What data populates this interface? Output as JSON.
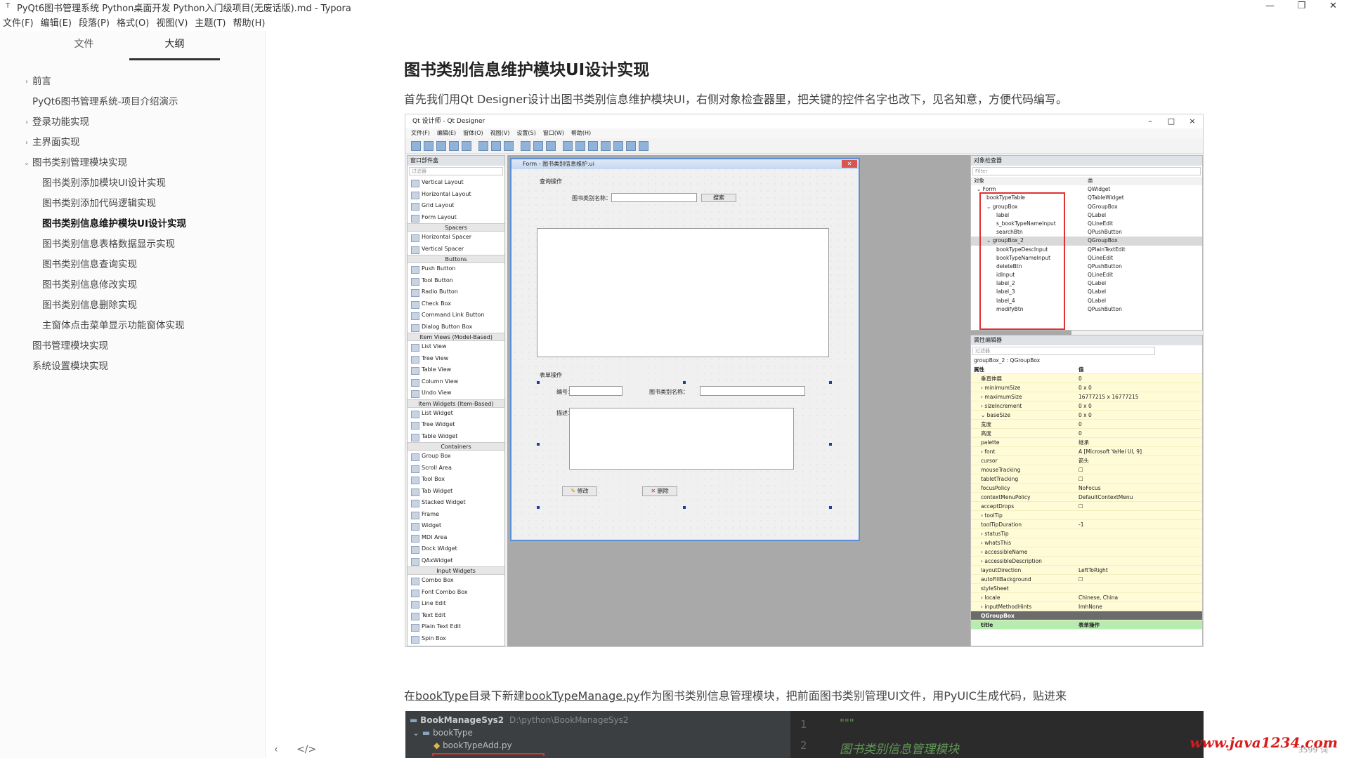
{
  "window": {
    "title": "PyQt6图书管理系统 Python桌面开发 Python入门级项目(无废话版).md - Typora",
    "min_symbol": "—",
    "max_symbol": "❐",
    "close_symbol": "✕"
  },
  "menu": [
    "文件(F)",
    "编辑(E)",
    "段落(P)",
    "格式(O)",
    "视图(V)",
    "主题(T)",
    "帮助(H)"
  ],
  "sidebar": {
    "tabs": [
      "文件",
      "大纲"
    ],
    "active_tab": 1,
    "outline": [
      {
        "label": "前言",
        "level": 0,
        "chevron": "›"
      },
      {
        "label": "PyQt6图书管理系统-项目介绍演示",
        "level": 0,
        "chevron": ""
      },
      {
        "label": "登录功能实现",
        "level": 0,
        "chevron": "›"
      },
      {
        "label": "主界面实现",
        "level": 0,
        "chevron": "›"
      },
      {
        "label": "图书类别管理模块实现",
        "level": 0,
        "chevron": "⌄"
      },
      {
        "label": "图书类别添加模块UI设计实现",
        "level": 1,
        "chevron": ""
      },
      {
        "label": "图书类别添加代码逻辑实现",
        "level": 1,
        "chevron": ""
      },
      {
        "label": "图书类别信息维护模块UI设计实现",
        "level": 1,
        "chevron": "",
        "active": true
      },
      {
        "label": "图书类别信息表格数据显示实现",
        "level": 1,
        "chevron": ""
      },
      {
        "label": "图书类别信息查询实现",
        "level": 1,
        "chevron": ""
      },
      {
        "label": "图书类别信息修改实现",
        "level": 1,
        "chevron": ""
      },
      {
        "label": "图书类别信息删除实现",
        "level": 1,
        "chevron": ""
      },
      {
        "label": "主窗体点击菜单显示功能窗体实现",
        "level": 1,
        "chevron": ""
      },
      {
        "label": "图书管理模块实现",
        "level": 0,
        "chevron": ""
      },
      {
        "label": "系统设置模块实现",
        "level": 0,
        "chevron": ""
      }
    ],
    "footer_left": "‹",
    "footer_code": "</>"
  },
  "content": {
    "heading": "图书类别信息维护模块UI设计实现",
    "para1": "首先我们用Qt Designer设计出图书类别信息维护模块UI，右侧对象检查器里，把关键的控件名字也改下，见名知意，方便代码编写。",
    "para2_pre": "在",
    "para2_link1": "bookType",
    "para2_mid": "目录下新建",
    "para2_link2": "bookTypeManage.py",
    "para2_post": "作为图书类别信息管理模块，把前面图书类别管理UI文件，用PyUIC生成代码，贴进来"
  },
  "designer": {
    "title": "Qt 设计师 - Qt Designer",
    "menu": [
      "文件(F)",
      "编辑(E)",
      "窗体(O)",
      "视图(V)",
      "设置(S)",
      "窗口(W)",
      "帮助(H)"
    ],
    "widgetbox_title": "窗口部件盒",
    "filter_placeholder": "过滤器",
    "widgets": [
      {
        "t": "item",
        "label": "Vertical Layout"
      },
      {
        "t": "item",
        "label": "Horizontal Layout"
      },
      {
        "t": "item",
        "label": "Grid Layout"
      },
      {
        "t": "item",
        "label": "Form Layout"
      },
      {
        "t": "cat",
        "label": "Spacers"
      },
      {
        "t": "item",
        "label": "Horizontal Spacer"
      },
      {
        "t": "item",
        "label": "Vertical Spacer"
      },
      {
        "t": "cat",
        "label": "Buttons"
      },
      {
        "t": "item",
        "label": "Push Button"
      },
      {
        "t": "item",
        "label": "Tool Button"
      },
      {
        "t": "item",
        "label": "Radio Button"
      },
      {
        "t": "item",
        "label": "Check Box"
      },
      {
        "t": "item",
        "label": "Command Link Button"
      },
      {
        "t": "item",
        "label": "Dialog Button Box"
      },
      {
        "t": "cat",
        "label": "Item Views (Model-Based)"
      },
      {
        "t": "item",
        "label": "List View"
      },
      {
        "t": "item",
        "label": "Tree View"
      },
      {
        "t": "item",
        "label": "Table View"
      },
      {
        "t": "item",
        "label": "Column View"
      },
      {
        "t": "item",
        "label": "Undo View"
      },
      {
        "t": "cat",
        "label": "Item Widgets (Item-Based)"
      },
      {
        "t": "item",
        "label": "List Widget"
      },
      {
        "t": "item",
        "label": "Tree Widget"
      },
      {
        "t": "item",
        "label": "Table Widget"
      },
      {
        "t": "cat",
        "label": "Containers"
      },
      {
        "t": "item",
        "label": "Group Box"
      },
      {
        "t": "item",
        "label": "Scroll Area"
      },
      {
        "t": "item",
        "label": "Tool Box"
      },
      {
        "t": "item",
        "label": "Tab Widget"
      },
      {
        "t": "item",
        "label": "Stacked Widget"
      },
      {
        "t": "item",
        "label": "Frame"
      },
      {
        "t": "item",
        "label": "Widget"
      },
      {
        "t": "item",
        "label": "MDI Area"
      },
      {
        "t": "item",
        "label": "Dock Widget"
      },
      {
        "t": "item",
        "label": "QAxWidget"
      },
      {
        "t": "cat",
        "label": "Input Widgets"
      },
      {
        "t": "item",
        "label": "Combo Box"
      },
      {
        "t": "item",
        "label": "Font Combo Box"
      },
      {
        "t": "item",
        "label": "Line Edit"
      },
      {
        "t": "item",
        "label": "Text Edit"
      },
      {
        "t": "item",
        "label": "Plain Text Edit"
      },
      {
        "t": "item",
        "label": "Spin Box"
      }
    ],
    "form": {
      "title": "Form - 图书类别信息维护.ui",
      "query_group": "查询操作",
      "query_label": "图书类别名称：",
      "search_btn": "搜索",
      "edit_group": "表单操作",
      "id_label": "编号：",
      "name_label": "图书类别名称：",
      "desc_label": "描述：",
      "modify_btn": "修改",
      "delete_btn": "删除"
    },
    "inspector": {
      "title": "对象检查器",
      "filter": "Filter",
      "col_object": "对象",
      "col_class": "类",
      "rows": [
        {
          "o": "⌄ Form",
          "c": "QWidget",
          "indent": 0
        },
        {
          "o": "bookTypeTable",
          "c": "QTableWidget",
          "indent": 1
        },
        {
          "o": "⌄ groupBox",
          "c": "QGroupBox",
          "indent": 1
        },
        {
          "o": "label",
          "c": "QLabel",
          "indent": 2
        },
        {
          "o": "s_bookTypeNameInput",
          "c": "QLineEdit",
          "indent": 2
        },
        {
          "o": "searchBtn",
          "c": "QPushButton",
          "indent": 2
        },
        {
          "o": "⌄ groupBox_2",
          "c": "QGroupBox",
          "indent": 1,
          "sel": true
        },
        {
          "o": "bookTypeDescInput",
          "c": "QPlainTextEdit",
          "indent": 2
        },
        {
          "o": "bookTypeNameInput",
          "c": "QLineEdit",
          "indent": 2
        },
        {
          "o": "deleteBtn",
          "c": "QPushButton",
          "indent": 2
        },
        {
          "o": "idInput",
          "c": "QLineEdit",
          "indent": 2
        },
        {
          "o": "label_2",
          "c": "QLabel",
          "indent": 2
        },
        {
          "o": "label_3",
          "c": "QLabel",
          "indent": 2
        },
        {
          "o": "label_4",
          "c": "QLabel",
          "indent": 2
        },
        {
          "o": "modifyBtn",
          "c": "QPushButton",
          "indent": 2
        }
      ]
    },
    "props": {
      "title": "属性编辑器",
      "filter": "过滤器",
      "object": "groupBox_2 : QGroupBox",
      "col_prop": "属性",
      "col_value": "值",
      "rows": [
        {
          "n": "垂直伸展",
          "v": "0"
        },
        {
          "n": "› minimumSize",
          "v": "0 x 0"
        },
        {
          "n": "› maximumSize",
          "v": "16777215 x 16777215"
        },
        {
          "n": "› sizeIncrement",
          "v": "0 x 0"
        },
        {
          "n": "⌄ baseSize",
          "v": "0 x 0"
        },
        {
          "n": "   宽度",
          "v": "0"
        },
        {
          "n": "   高度",
          "v": "0"
        },
        {
          "n": "palette",
          "v": "继承"
        },
        {
          "n": "› font",
          "v": "A  [Microsoft YaHei UI, 9]"
        },
        {
          "n": "cursor",
          "v": "箭头"
        },
        {
          "n": "mouseTracking",
          "v": "☐"
        },
        {
          "n": "tabletTracking",
          "v": "☐"
        },
        {
          "n": "focusPolicy",
          "v": "NoFocus"
        },
        {
          "n": "contextMenuPolicy",
          "v": "DefaultContextMenu"
        },
        {
          "n": "acceptDrops",
          "v": "☐"
        },
        {
          "n": "› toolTip",
          "v": ""
        },
        {
          "n": "toolTipDuration",
          "v": "-1"
        },
        {
          "n": "› statusTip",
          "v": ""
        },
        {
          "n": "› whatsThis",
          "v": ""
        },
        {
          "n": "› accessibleName",
          "v": ""
        },
        {
          "n": "› accessibleDescription",
          "v": ""
        },
        {
          "n": "layoutDirection",
          "v": "LeftToRight"
        },
        {
          "n": "autoFillBackground",
          "v": "☐"
        },
        {
          "n": "styleSheet",
          "v": ""
        },
        {
          "n": "› locale",
          "v": "Chinese, China"
        },
        {
          "n": "› inputMethodHints",
          "v": "ImhNone"
        }
      ],
      "class_row": "QGroupBox",
      "title_row": {
        "n": "title",
        "v": "表单操作"
      }
    }
  },
  "ide": {
    "project": "BookManageSys2",
    "project_path": "D:\\python\\BookManageSys2",
    "folder": "bookType",
    "file": "bookTypeAdd.py",
    "line1": "1",
    "line2": "2",
    "code1": "\"\"\"",
    "code2": "图书类别信息管理模块"
  },
  "watermark": "www.java1234.com",
  "wordcount": "3599 词"
}
